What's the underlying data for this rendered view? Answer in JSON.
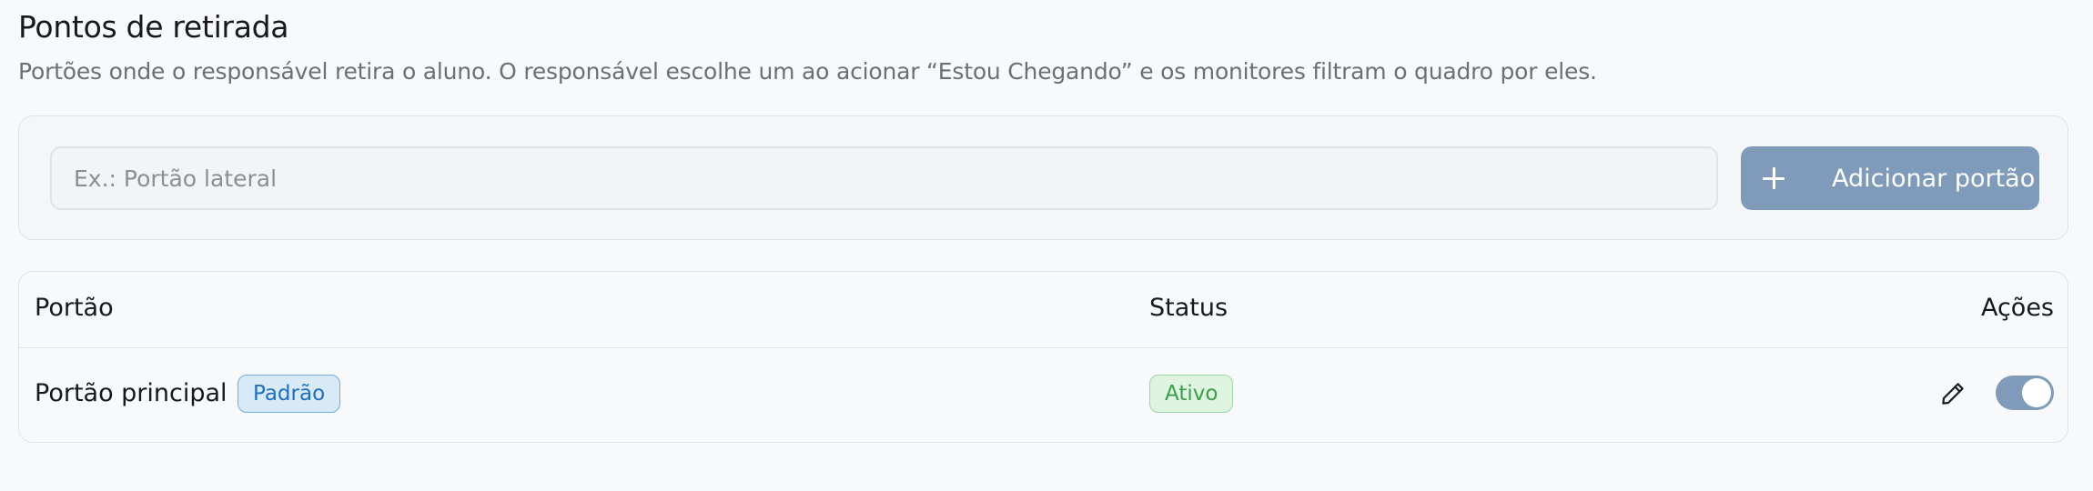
{
  "header": {
    "title": "Pontos de retirada",
    "subtitle": "Portões onde o responsável retira o aluno. O responsável escolhe um ao acionar “Estou Chegando” e os monitores filtram o quadro por eles."
  },
  "add_form": {
    "input_placeholder": "Ex.: Portão lateral",
    "input_value": "",
    "add_button_label": "Adicionar portão",
    "add_button_icon": "plus-icon"
  },
  "table": {
    "columns": [
      "Portão",
      "Status",
      "Ações"
    ],
    "rows": [
      {
        "name": "Portão principal",
        "default_badge": "Padrão",
        "status": "Ativo",
        "edit_icon": "pencil-icon",
        "active_toggle": true
      }
    ]
  },
  "colors": {
    "accent": "#7f9bb9",
    "default_badge_bg": "#d8e9f8",
    "default_badge_text": "#1d6fc4",
    "status_active_bg": "#def3e0",
    "status_active_text": "#3aa04a"
  }
}
